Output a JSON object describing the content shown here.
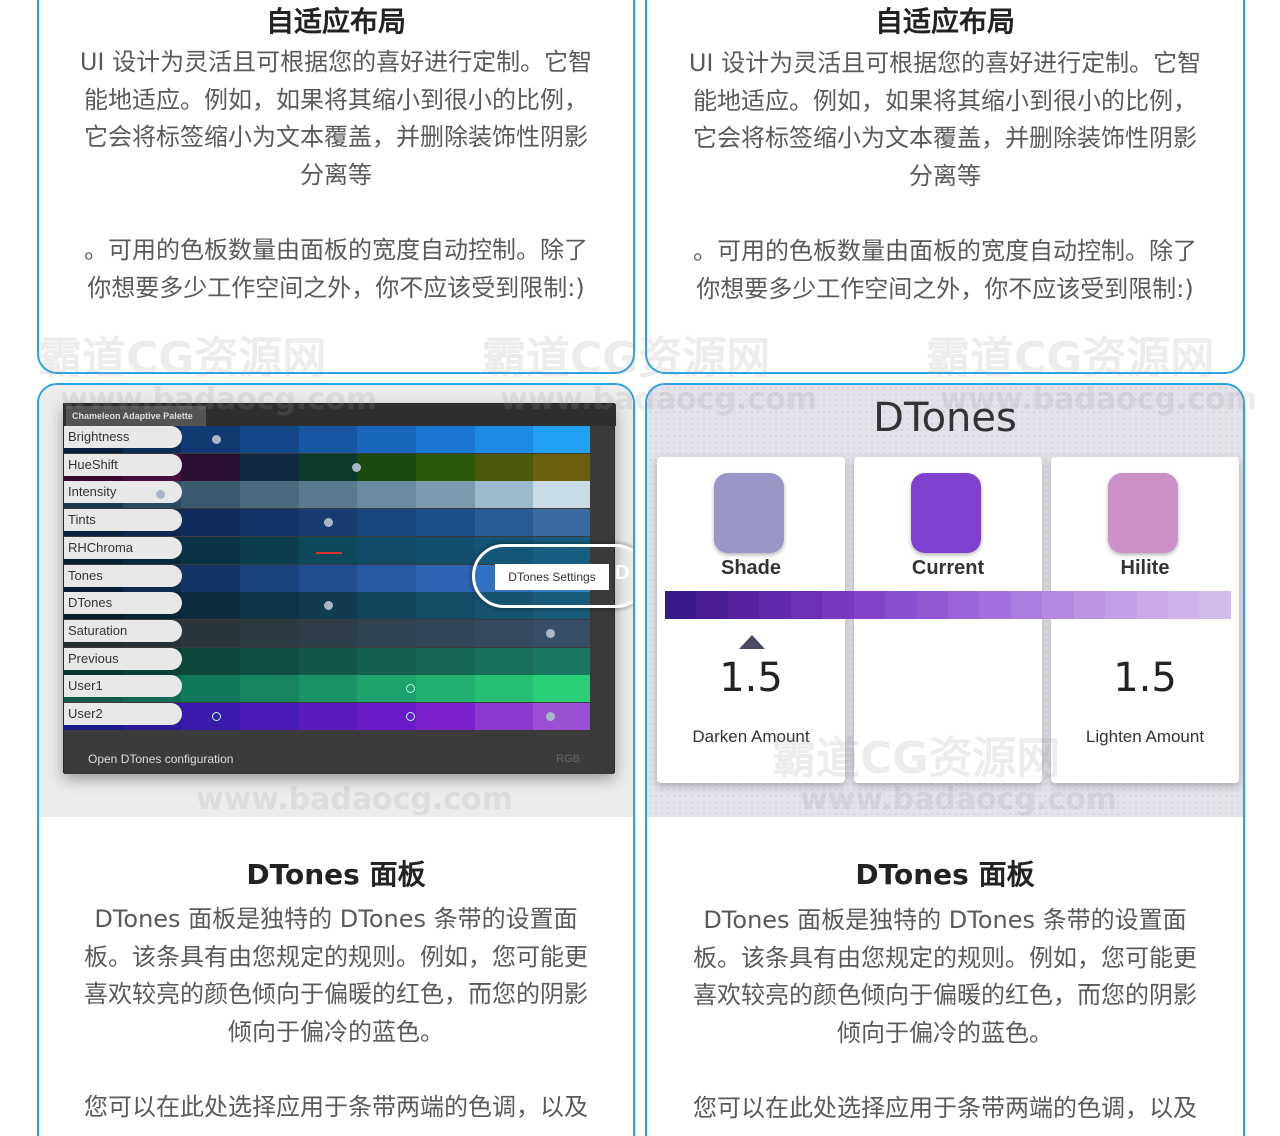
{
  "cards": [
    {
      "title": "自适应布局",
      "p1": [
        "UI 设计为灵活且可根据您的喜好进行定制。它智",
        "能地适应。例如，如果将其缩小到很小的比例，",
        "它会将标签缩小为文本覆盖，并删除装饰性阴影",
        "分离等"
      ],
      "p2": [
        "。可用的色板数量由面板的宽度自动控制。除了",
        "你想要多少工作空间之外，你不应该受到限制:)"
      ]
    },
    {
      "title": "自适应布局",
      "p1": [
        "UI 设计为灵活且可根据您的喜好进行定制。它智",
        "能地适应。例如，如果将其缩小到很小的比例，",
        "它会将标签缩小为文本覆盖，并删除装饰性阴影",
        "分离等"
      ],
      "p2": [
        "。可用的色板数量由面板的宽度自动控制。除了",
        "你想要多少工作空间之外，你不应该受到限制:)"
      ]
    },
    {
      "title": "DTones 面板",
      "p1": [
        "DTones 面板是独特的 DTones 条带的设置面",
        "板。该条具有由您规定的规则。例如，您可能更",
        "喜欢较亮的颜色倾向于偏暖的红色，而您的阴影",
        "倾向于偏冷的蓝色。"
      ],
      "p2": [
        "您可以在此处选择应用于条带两端的色调，以及"
      ]
    },
    {
      "title": "DTones 面板",
      "p1": [
        "DTones 面板是独特的 DTones 条带的设置面",
        "板。该条具有由您规定的规则。例如，您可能更",
        "喜欢较亮的颜色倾向于偏暖的红色，而您的阴影",
        "倾向于偏冷的蓝色。"
      ],
      "p2": [
        "您可以在此处选择应用于条带两端的色调，以及"
      ]
    }
  ],
  "chameleon": {
    "panel_title": "Chameleon Adaptive Palette",
    "rows": [
      "Brightness",
      "HueShift",
      "Intensity",
      "Tints",
      "RHChroma",
      "Tones",
      "DTones",
      "Saturation",
      "Previous",
      "User1",
      "User2"
    ],
    "callout_label": "DTones Settings",
    "callout_key": "D",
    "footer": "Open DTones configuration",
    "mode": "RGB"
  },
  "dtones": {
    "title": "DTones",
    "columns": [
      {
        "label": "Shade",
        "color": "#9a97c8",
        "value": "1.5",
        "sub": "Darken Amount"
      },
      {
        "label": "Current",
        "color": "#8040d0",
        "value": "",
        "sub": ""
      },
      {
        "label": "Hilite",
        "color": "#cc90c8",
        "value": "1.5",
        "sub": "Lighten Amount"
      }
    ]
  },
  "watermark": {
    "big": "霸道CG资源网",
    "small": "www.badaocg.com"
  }
}
